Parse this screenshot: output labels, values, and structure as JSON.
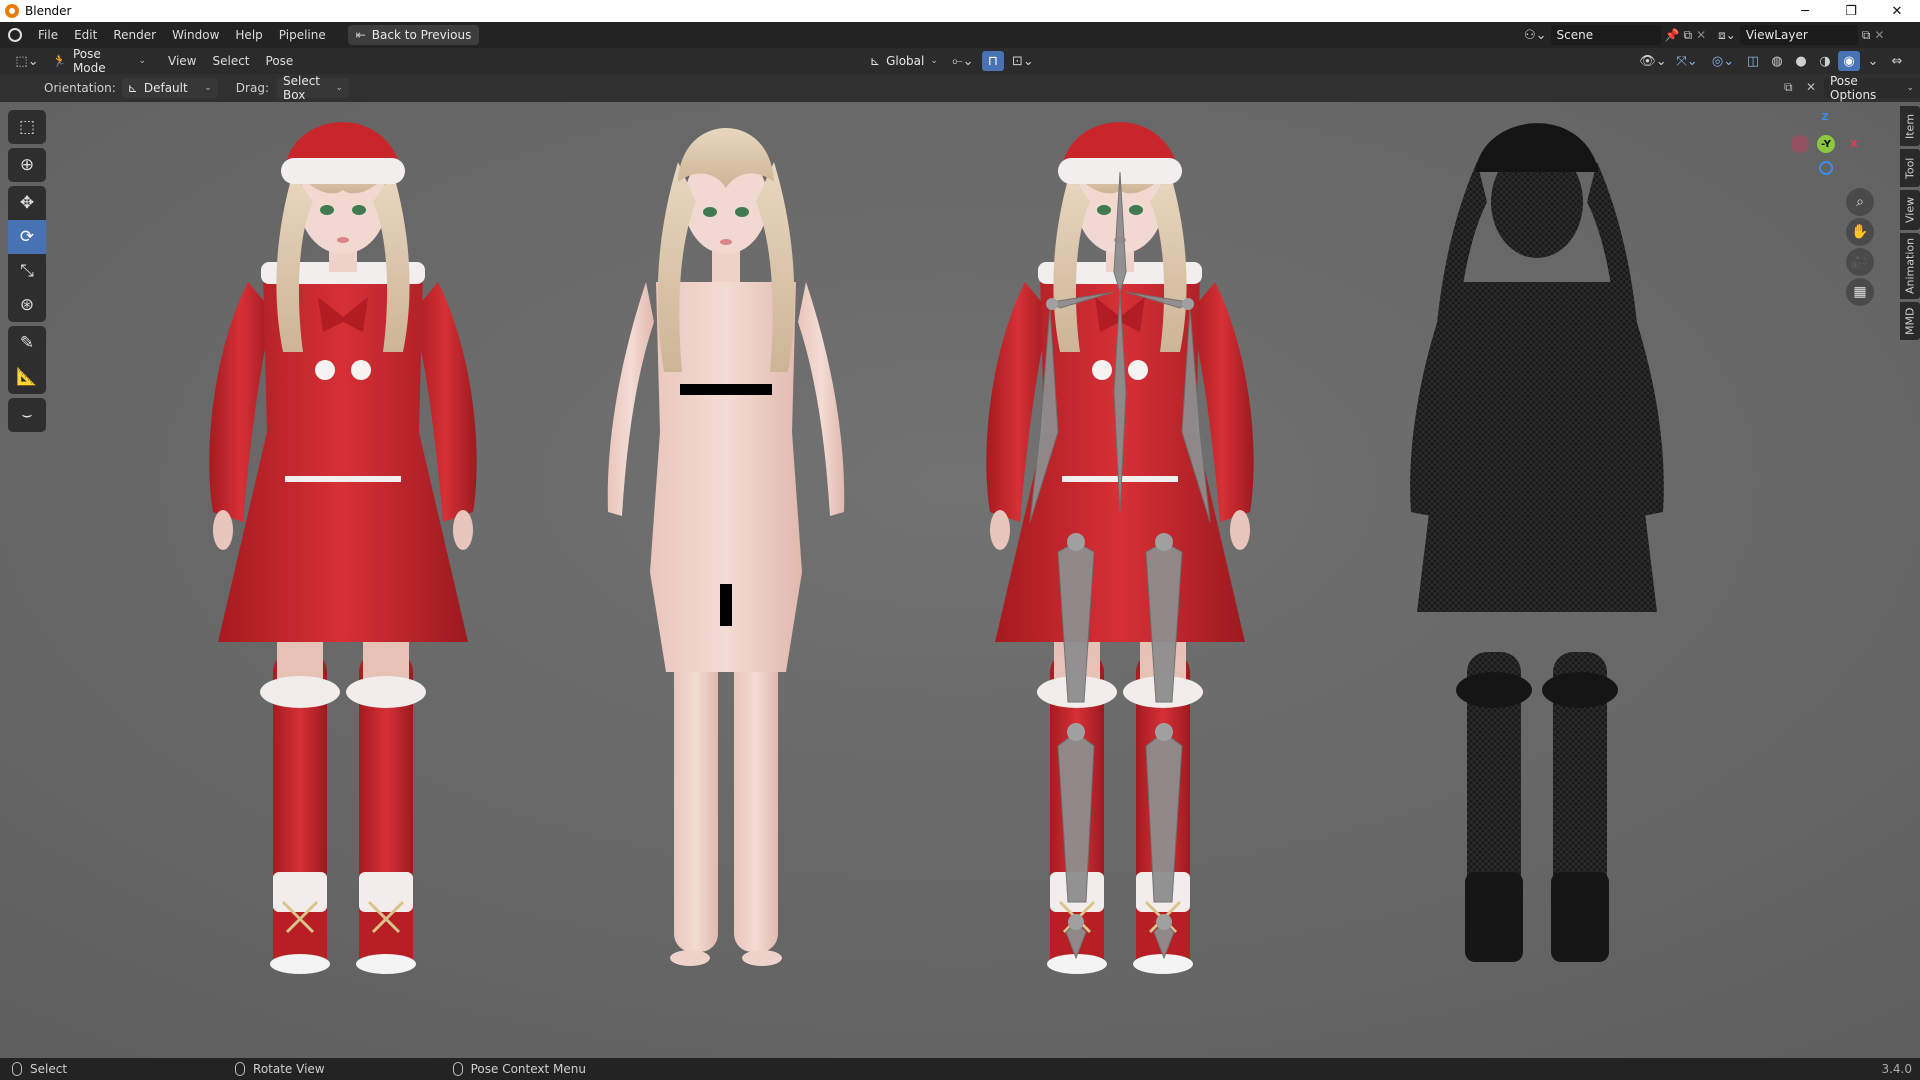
{
  "window": {
    "title": "Blender",
    "min": "─",
    "restore": "❐",
    "close": "✕"
  },
  "topbar": {
    "menus": [
      "File",
      "Edit",
      "Render",
      "Window",
      "Help",
      "Pipeline"
    ],
    "back_button": "Back to Previous",
    "scene": "Scene",
    "view_layer": "ViewLayer"
  },
  "header": {
    "mode": "Pose Mode",
    "menus": [
      "View",
      "Select",
      "Pose"
    ],
    "transform_orientation": "Global"
  },
  "tool_settings": {
    "orientation_label": "Orientation:",
    "orientation_value": "Default",
    "drag_label": "Drag:",
    "drag_value": "Select Box",
    "pose_options": "Pose Options"
  },
  "sidebar_tabs": [
    "Item",
    "Tool",
    "View",
    "Animation",
    "MMD"
  ],
  "gizmo": {
    "z": "Z",
    "y": "-Y",
    "x": "X"
  },
  "status": {
    "select": "Select",
    "rotate": "Rotate View",
    "context": "Pose Context Menu",
    "version": "3.4.0"
  },
  "colors": {
    "accent": "#4772b3",
    "viewport": "#6a6a6a",
    "axis_x": "#e8395a",
    "axis_y": "#8dc63f",
    "axis_z": "#3d8de8",
    "costume_red": "#c8262b"
  }
}
